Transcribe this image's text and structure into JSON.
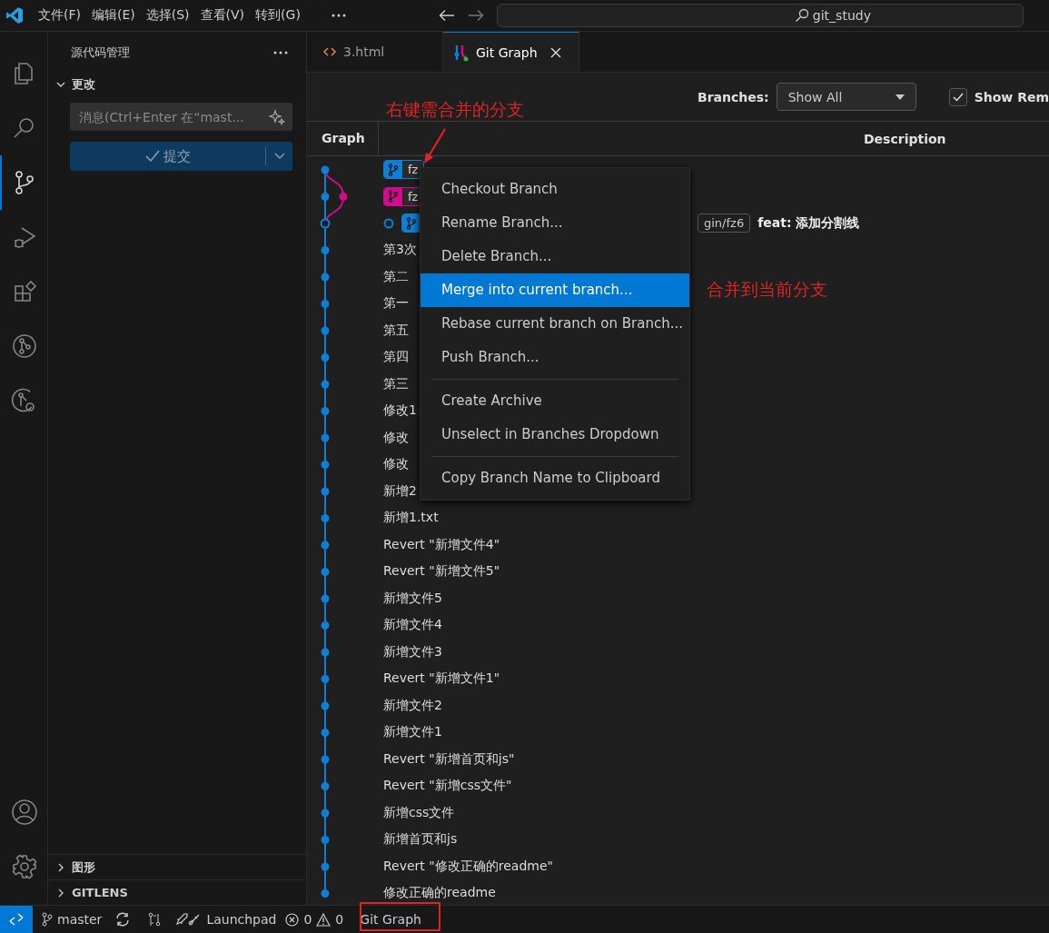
{
  "title_bar": {
    "menus": [
      "文件(F)",
      "编辑(E)",
      "选择(S)",
      "查看(V)",
      "转到(G)"
    ],
    "search": {
      "value": "git_study"
    }
  },
  "activity_bar": {
    "items": [
      {
        "kind": "files",
        "selected": false
      },
      {
        "kind": "search",
        "selected": false
      },
      {
        "kind": "source-control",
        "selected": true
      },
      {
        "kind": "debug",
        "selected": false
      },
      {
        "kind": "extensions",
        "selected": false
      },
      {
        "kind": "git-graph",
        "selected": false
      },
      {
        "kind": "gitlens",
        "selected": false
      }
    ],
    "bottom": [
      {
        "kind": "account"
      },
      {
        "kind": "settings"
      }
    ]
  },
  "sidebar": {
    "title": "源代码管理",
    "section": {
      "label": "更改",
      "expanded": true
    },
    "message": {
      "placeholder": "消息(Ctrl+Enter 在“mast..."
    },
    "commit_button": {
      "label": "提交",
      "disabled": true
    },
    "panels": [
      {
        "label": "图形",
        "expanded": false
      },
      {
        "label": "GITLENS",
        "expanded": false
      }
    ]
  },
  "tabs": [
    {
      "label": "3.html",
      "kind": "html",
      "selected": false
    },
    {
      "label": "Git Graph",
      "kind": "git-graph",
      "selected": true
    }
  ],
  "toolbar": {
    "branches_label": "Branches:",
    "branches_value": "Show All",
    "show_remote": {
      "label": "Show Rem",
      "checked": true
    }
  },
  "table": {
    "columns": [
      "Graph",
      "Description"
    ],
    "rows": [
      {
        "head": false,
        "refs": [
          {
            "kind": "branch",
            "name": "fz",
            "color": "#0f7fd6"
          }
        ]
      },
      {
        "head": false,
        "refs": [
          {
            "kind": "branch",
            "name": "fz",
            "color": "#d10d8c"
          }
        ]
      },
      {
        "head": true,
        "refs": [
          {
            "kind": "branch",
            "color": "#0f7fd6"
          },
          {
            "kind": "remote",
            "name": "gin/fz6"
          }
        ],
        "message": "feat: 添加分割线"
      },
      {
        "head": false,
        "message": "第3次"
      },
      {
        "head": false,
        "message": "第二"
      },
      {
        "head": false,
        "message": "第一"
      },
      {
        "head": false,
        "message": "第五"
      },
      {
        "head": false,
        "message": "第四"
      },
      {
        "head": false,
        "message": "第三"
      },
      {
        "head": false,
        "message": "修改1"
      },
      {
        "head": false,
        "message": "修改"
      },
      {
        "head": false,
        "message": "修改"
      },
      {
        "head": false,
        "message": "新增2"
      },
      {
        "head": false,
        "message": "新增1.txt"
      },
      {
        "head": false,
        "message": "Revert \"新增文件4\""
      },
      {
        "head": false,
        "message": "Revert \"新增文件5\""
      },
      {
        "head": false,
        "message": "新增文件5"
      },
      {
        "head": false,
        "message": "新增文件4"
      },
      {
        "head": false,
        "message": "新增文件3"
      },
      {
        "head": false,
        "message": "Revert \"新增文件1\""
      },
      {
        "head": false,
        "message": "新增文件2"
      },
      {
        "head": false,
        "message": "新增文件1"
      },
      {
        "head": false,
        "message": "Revert \"新增首页和js\""
      },
      {
        "head": false,
        "message": "Revert \"新增css文件\""
      },
      {
        "head": false,
        "message": "新增css文件"
      },
      {
        "head": false,
        "message": "新增首页和js"
      },
      {
        "head": false,
        "message": "Revert \"修改正确的readme\""
      },
      {
        "head": false,
        "message": "修改正确的readme"
      }
    ]
  },
  "context_menu": {
    "groups": [
      [
        {
          "label": "Checkout Branch",
          "selected": false
        },
        {
          "label": "Rename Branch...",
          "selected": false
        },
        {
          "label": "Delete Branch...",
          "selected": false
        },
        {
          "label": "Merge into current branch...",
          "selected": true
        },
        {
          "label": "Rebase current branch on Branch...",
          "selected": false
        },
        {
          "label": "Push Branch...",
          "selected": false
        }
      ],
      [
        {
          "label": "Create Archive",
          "selected": false
        },
        {
          "label": "Unselect in Branches Dropdown",
          "selected": false
        }
      ],
      [
        {
          "label": "Copy Branch Name to Clipboard",
          "selected": false
        }
      ]
    ]
  },
  "annotations": [
    {
      "text": "右键需合并的分支"
    },
    {
      "text": "合并到当前分支"
    }
  ],
  "status_bar": {
    "branch": "master",
    "launchpad": "Launchpad",
    "errors": "0",
    "warnings": "0",
    "git_graph": "Git Graph"
  }
}
